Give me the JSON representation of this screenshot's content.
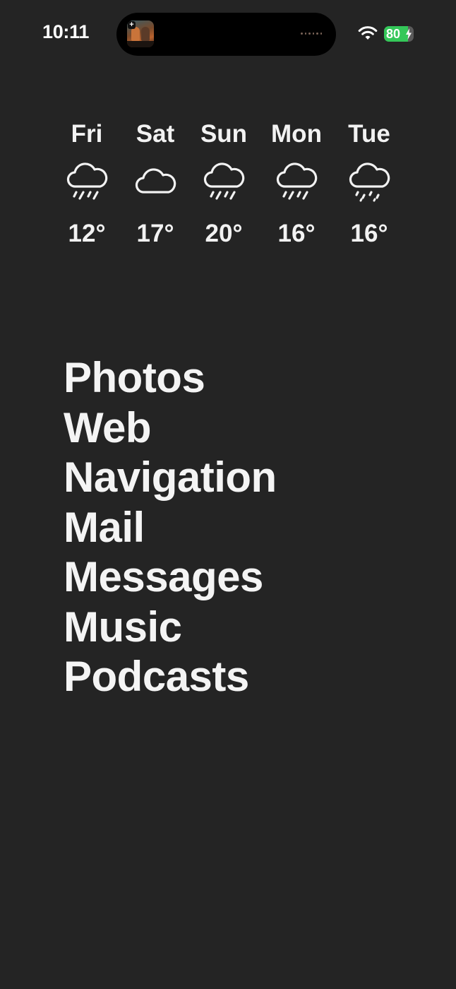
{
  "status_bar": {
    "time": "10:11",
    "battery_percent": 80,
    "battery_label": "80",
    "charging": true,
    "now_playing_artwork_icon": "album-artwork-icon"
  },
  "weather": {
    "days": [
      {
        "day": "Fri",
        "icon": "rain-icon",
        "temp": "12°"
      },
      {
        "day": "Sat",
        "icon": "cloud-icon",
        "temp": "17°"
      },
      {
        "day": "Sun",
        "icon": "rain-icon",
        "temp": "20°"
      },
      {
        "day": "Mon",
        "icon": "rain-icon",
        "temp": "16°"
      },
      {
        "day": "Tue",
        "icon": "drizzle-icon",
        "temp": "16°"
      }
    ]
  },
  "apps": [
    {
      "label": "Photos"
    },
    {
      "label": "Web"
    },
    {
      "label": "Navigation"
    },
    {
      "label": "Mail"
    },
    {
      "label": "Messages"
    },
    {
      "label": "Music"
    },
    {
      "label": "Podcasts"
    }
  ],
  "colors": {
    "background": "#242424",
    "text": "#f2f2f2",
    "battery_fill": "#34c759"
  }
}
